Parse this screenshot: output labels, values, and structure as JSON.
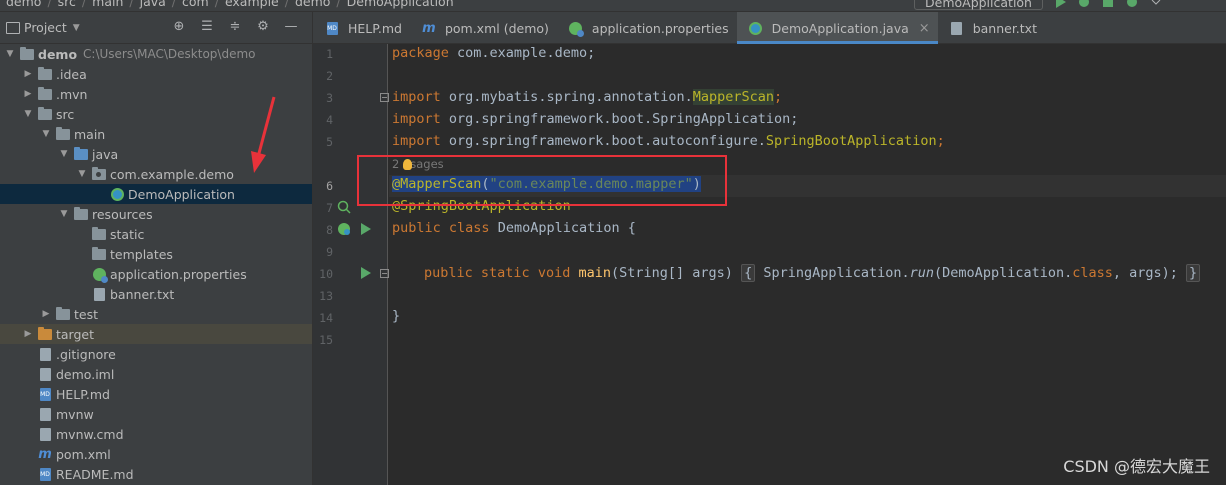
{
  "breadcrumb": [
    "demo",
    "src",
    "main",
    "java",
    "com",
    "example",
    "demo",
    "DemoApplication"
  ],
  "run_config": "DemoApplication",
  "project_panel": {
    "title": "Project",
    "tree": [
      {
        "label": "demo",
        "path": "C:\\Users\\MAC\\Desktop\\demo",
        "depth": 0,
        "expanded": true,
        "icon": "folder-icon",
        "bold": true
      },
      {
        "label": ".idea",
        "depth": 1,
        "expanded": false,
        "icon": "folder-icon"
      },
      {
        "label": ".mvn",
        "depth": 1,
        "expanded": false,
        "icon": "folder-icon"
      },
      {
        "label": "src",
        "depth": 1,
        "expanded": true,
        "icon": "folder-icon"
      },
      {
        "label": "main",
        "depth": 2,
        "expanded": true,
        "icon": "folder-icon"
      },
      {
        "label": "java",
        "depth": 3,
        "expanded": true,
        "icon": "source-folder-icon"
      },
      {
        "label": "com.example.demo",
        "depth": 4,
        "expanded": true,
        "icon": "package-icon"
      },
      {
        "label": "DemoApplication",
        "depth": 5,
        "icon": "spring-class-icon",
        "selected": true
      },
      {
        "label": "resources",
        "depth": 3,
        "expanded": true,
        "icon": "resources-folder-icon"
      },
      {
        "label": "static",
        "depth": 4,
        "icon": "folder-icon"
      },
      {
        "label": "templates",
        "depth": 4,
        "icon": "folder-icon"
      },
      {
        "label": "application.properties",
        "depth": 4,
        "icon": "spring-properties-icon"
      },
      {
        "label": "banner.txt",
        "depth": 4,
        "icon": "text-file-icon"
      },
      {
        "label": "test",
        "depth": 2,
        "expanded": false,
        "icon": "folder-icon"
      },
      {
        "label": "target",
        "depth": 1,
        "expanded": false,
        "icon": "excluded-folder-icon",
        "highlighted": true
      },
      {
        "label": ".gitignore",
        "depth": 1,
        "icon": "gitignore-file-icon"
      },
      {
        "label": "demo.iml",
        "depth": 1,
        "icon": "iml-file-icon"
      },
      {
        "label": "HELP.md",
        "depth": 1,
        "icon": "markdown-file-icon"
      },
      {
        "label": "mvnw",
        "depth": 1,
        "icon": "text-file-icon"
      },
      {
        "label": "mvnw.cmd",
        "depth": 1,
        "icon": "text-file-icon"
      },
      {
        "label": "pom.xml",
        "depth": 1,
        "icon": "maven-file-icon"
      },
      {
        "label": "README.md",
        "depth": 1,
        "icon": "markdown-file-icon"
      }
    ]
  },
  "tabs": [
    {
      "label": "HELP.md",
      "icon": "markdown-file-icon",
      "active": false
    },
    {
      "label": "pom.xml (demo)",
      "icon": "maven-file-icon",
      "active": false
    },
    {
      "label": "application.properties",
      "icon": "spring-properties-icon",
      "active": false
    },
    {
      "label": "DemoApplication.java",
      "icon": "spring-class-icon",
      "active": true
    },
    {
      "label": "banner.txt",
      "icon": "text-file-icon",
      "active": false
    }
  ],
  "editor": {
    "line_numbers": [
      "1",
      "2",
      "3",
      "4",
      "5",
      "6",
      "7",
      "8",
      "9",
      "10",
      "13",
      "14",
      "15"
    ],
    "usages_hint": "2 usages",
    "lines": {
      "l1_kw": "package",
      "l1_rest": " com.example.demo;",
      "l3_kw": "import",
      "l3_pkg": " org.mybatis.spring.annotation.",
      "l3_cls": "MapperScan",
      "l3_end": ";",
      "l4_kw": "import",
      "l4_rest": " org.springframework.boot.SpringApplication;",
      "l5_kw": "import",
      "l5_pkg": " org.springframework.boot.autoconfigure.",
      "l5_cls": "SpringBootApplication",
      "l5_end": ";",
      "l6_ann": "@MapperScan",
      "l6_open": "(",
      "l6_str": "\"com.example.demo.mapper\"",
      "l6_close": ")",
      "l7_ann": "@SpringBootApplication",
      "l8_kw1": "public",
      "l8_kw2": "class",
      "l8_rest": " DemoApplication {",
      "l10_kw1": "public",
      "l10_kw2": "static",
      "l10_kw3": "void",
      "l10_fn": "main",
      "l10_args": "(String[] args)",
      "l10_fold_open": "{",
      "l10_call": " SpringApplication.",
      "l10_run": "run",
      "l10_params1": "(DemoApplication.",
      "l10_kwclass": "class",
      "l10_params2": ", args);",
      "l10_fold_close": "}",
      "l14": "}"
    }
  },
  "watermark": "CSDN @德宏大魔王"
}
